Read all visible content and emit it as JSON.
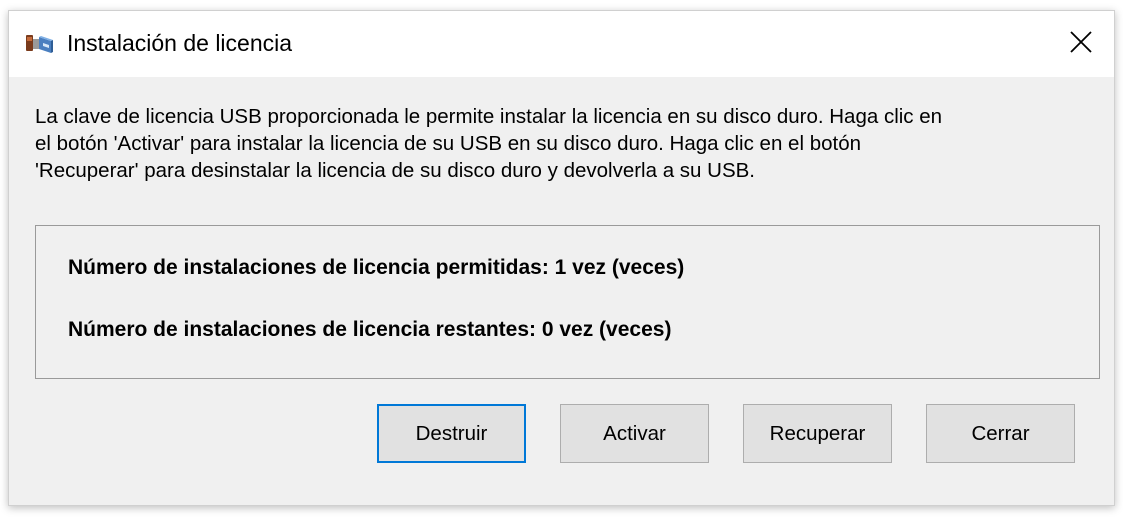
{
  "window": {
    "title": "Instalación de licencia",
    "app_icon": "usb-installer-icon",
    "close_icon": "close-icon"
  },
  "description": {
    "lines": [
      "La clave de licencia USB proporcionada le permite instalar la licencia en su disco duro. Haga clic en",
      "el botón 'Activar' para instalar la licencia de su USB en su disco duro. Haga clic en el botón",
      "'Recuperar' para desinstalar la licencia de su disco duro y devolverla  a su USB."
    ]
  },
  "info": {
    "allowed": "Número de instalaciones de licencia permitidas: 1 vez (veces)",
    "remaining": "Número de instalaciones de licencia restantes: 0 vez (veces)"
  },
  "buttons": {
    "destruir": "Destruir",
    "activar": "Activar",
    "recuperar": "Recuperar",
    "cerrar": "Cerrar"
  },
  "colors": {
    "dialog_bg": "#f0f0f0",
    "titlebar_bg": "#ffffff",
    "button_bg": "#e1e1e1",
    "default_button_border": "#0078d7"
  }
}
